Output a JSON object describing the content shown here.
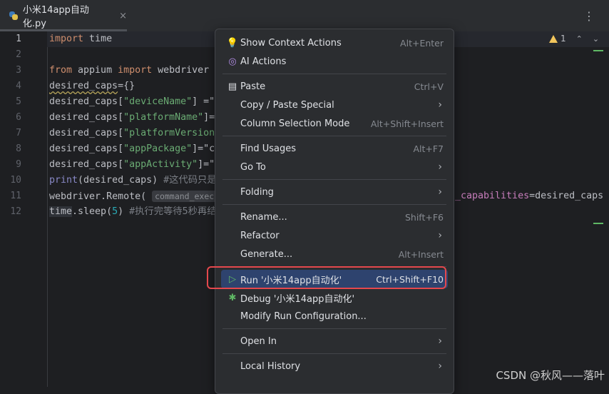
{
  "tab": {
    "title": "小米14app自动化.py",
    "close": "×",
    "more": "⋮"
  },
  "inspection": {
    "count": "1",
    "up": "⌃",
    "down": "⌄"
  },
  "lines": [
    {
      "num": "1"
    },
    {
      "num": "2"
    },
    {
      "num": "3"
    },
    {
      "num": "4"
    },
    {
      "num": "5"
    },
    {
      "num": "6"
    },
    {
      "num": "7"
    },
    {
      "num": "8"
    },
    {
      "num": "9"
    },
    {
      "num": "10"
    },
    {
      "num": "11"
    },
    {
      "num": "12"
    }
  ],
  "code": {
    "l1a": "import",
    "l1b": " time",
    "l3a": "from",
    "l3b": " appium ",
    "l3c": "import",
    "l3d": " webdriver",
    "l4": "desired_caps",
    "l4b": "={}",
    "l5a": "desired_caps[",
    "l5b": "\"deviceName\"",
    "l5c": "] =\"",
    "l6a": "desired_caps[",
    "l6b": "\"platformName\"",
    "l6c": "]=",
    "l7a": "desired_caps[",
    "l7b": "\"platformVersion",
    "l8a": "desired_caps[",
    "l8b": "\"appPackage\"",
    "l8c": "]=\"c",
    "l9a": "desired_caps[",
    "l9b": "\"appActivity\"",
    "l9c": "]=\"",
    "l10a": "print",
    "l10b": "(desired_caps) ",
    "l10c": "#这代码只是",
    "l11a": "webdriver.",
    "l11b": "Remote",
    "l11c": "( ",
    "l11d": "command_exec",
    "l11e": "d_capabilities",
    "l11f": "=desired_caps",
    "l12a": "time",
    "l12b": ".sleep(",
    "l12c": "5",
    "l12d": ") ",
    "l12e": "#执行完等待5秒再结"
  },
  "menu": {
    "items": [
      {
        "label": "Show Context Actions",
        "shortcut": "Alt+Enter"
      },
      {
        "label": "AI Actions",
        "shortcut": ""
      },
      {
        "label": "Paste",
        "shortcut": "Ctrl+V"
      },
      {
        "label": "Copy / Paste Special",
        "shortcut": ""
      },
      {
        "label": "Column Selection Mode",
        "shortcut": "Alt+Shift+Insert"
      },
      {
        "label": "Find Usages",
        "shortcut": "Alt+F7"
      },
      {
        "label": "Go To",
        "shortcut": ""
      },
      {
        "label": "Folding",
        "shortcut": ""
      },
      {
        "label": "Rename...",
        "shortcut": "Shift+F6"
      },
      {
        "label": "Refactor",
        "shortcut": ""
      },
      {
        "label": "Generate...",
        "shortcut": "Alt+Insert"
      },
      {
        "label": "Run '小米14app自动化'",
        "shortcut": "Ctrl+Shift+F10"
      },
      {
        "label": "Debug '小米14app自动化'",
        "shortcut": ""
      },
      {
        "label": "Modify Run Configuration...",
        "shortcut": ""
      },
      {
        "label": "Open In",
        "shortcut": ""
      },
      {
        "label": "Local History",
        "shortcut": ""
      }
    ],
    "submenu_arrow": "›"
  },
  "icons": {
    "bulb": "lightbulb-icon",
    "ai": "ai-icon",
    "paste": "clipboard-icon",
    "run": "play-icon",
    "debug": "bug-icon"
  },
  "watermark": "CSDN @秋风——落叶",
  "colors": {
    "selected": "#2e436e",
    "highlight_box": "#e5484d"
  }
}
